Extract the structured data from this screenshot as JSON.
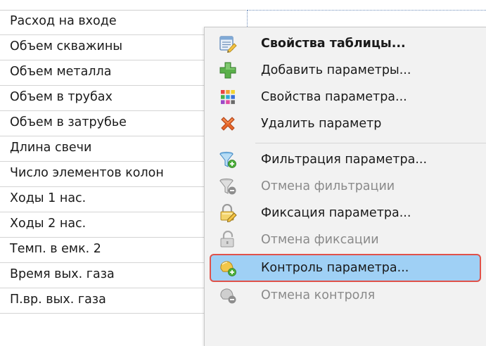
{
  "table": {
    "rows": [
      {
        "label": "Расход на входе"
      },
      {
        "label": "Объем скважины"
      },
      {
        "label": "Объем металла"
      },
      {
        "label": "Объем в трубах"
      },
      {
        "label": "Объем в затрубье"
      },
      {
        "label": "Длина свечи"
      },
      {
        "label": "Число элементов колон"
      },
      {
        "label": "Ходы 1 нас."
      },
      {
        "label": "Ходы 2 нас."
      },
      {
        "label": "Темп. в емк. 2"
      },
      {
        "label": "Время вых. газа"
      },
      {
        "label": "П.вр. вых. газа"
      }
    ]
  },
  "context_menu": {
    "items": [
      {
        "label": "Свойства таблицы...",
        "icon": "table-properties-icon",
        "bold": true,
        "enabled": true
      },
      {
        "label": "Добавить параметры...",
        "icon": "plus-icon",
        "enabled": true
      },
      {
        "label": "Свойства параметра...",
        "icon": "parameter-grid-icon",
        "enabled": true
      },
      {
        "label": "Удалить параметр",
        "icon": "delete-x-icon",
        "enabled": true
      },
      {
        "label": "Фильтрация параметра...",
        "icon": "filter-add-icon",
        "enabled": true
      },
      {
        "label": "Отмена фильтрации",
        "icon": "filter-remove-icon",
        "enabled": false
      },
      {
        "label": "Фиксация параметра...",
        "icon": "lock-fix-icon",
        "enabled": true
      },
      {
        "label": "Отмена фиксации",
        "icon": "unlock-icon",
        "enabled": false
      },
      {
        "label": "Контроль параметра...",
        "icon": "control-bell-icon",
        "enabled": true,
        "highlighted": true
      },
      {
        "label": "Отмена контроля",
        "icon": "control-remove-icon",
        "enabled": false
      }
    ]
  },
  "colors": {
    "menu_background": "#f2f2f2",
    "highlight_fill": "#9fd0f5",
    "highlight_border": "#e0524a",
    "disabled_text": "#8a8a8a"
  }
}
